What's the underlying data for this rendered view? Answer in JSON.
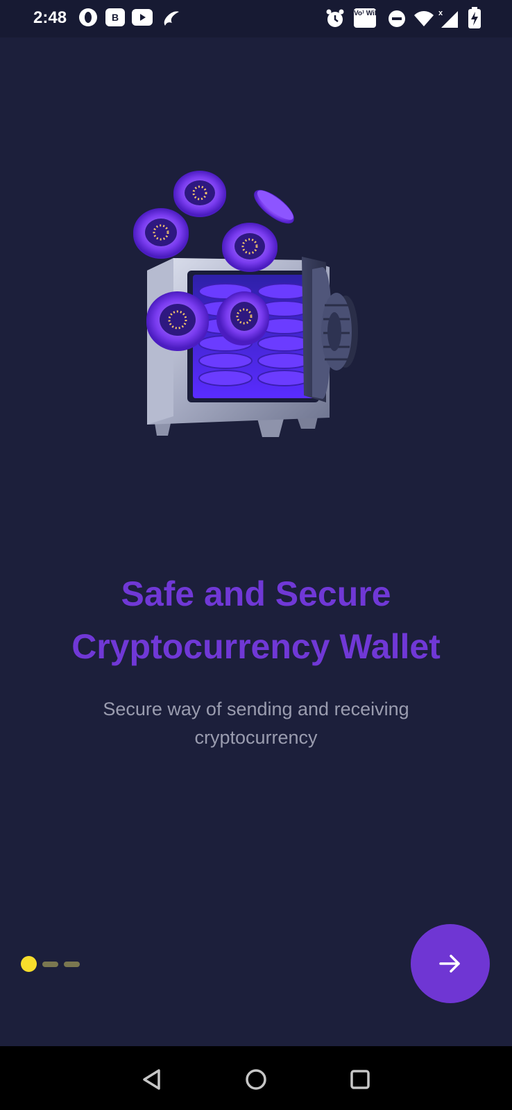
{
  "status_bar": {
    "time": "2:48",
    "left_icons": [
      "opera-icon",
      "b-app-icon",
      "youtube-icon",
      "airtel-icon"
    ],
    "right_icons": [
      "alarm-icon",
      "vowifi-icon",
      "dnd-icon",
      "wifi-icon",
      "signal-icon",
      "battery-charging-icon"
    ],
    "vowifi_label": "Vo⁾ WiFi"
  },
  "onboarding": {
    "illustration": "crypto-safe-with-coins",
    "title": "Safe and Secure Cryptocurrency Wallet",
    "subtitle": "Secure way of sending and receiving cryptocurrency",
    "page_indicator": {
      "current": 1,
      "total": 3
    },
    "next_button_icon": "arrow-right-icon"
  },
  "colors": {
    "background": "#1c1f3b",
    "accent": "#6f36d3",
    "title": "#7038d6",
    "subtitle": "#9a9caf",
    "indicator_active": "#f7dd2c",
    "indicator_inactive": "#7a7750"
  },
  "navigation_bar": {
    "buttons": [
      "back-icon",
      "home-icon",
      "recents-icon"
    ]
  }
}
